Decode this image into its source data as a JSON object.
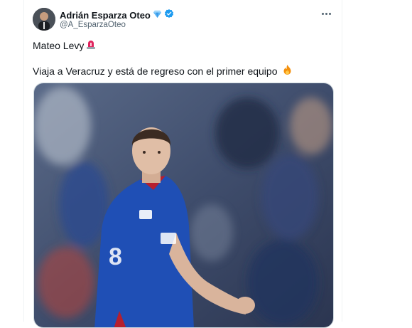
{
  "tweet": {
    "author_name": "Adrián Esparza Oteo",
    "author_handle": "@A_EsparzaOteo",
    "line1_text": "Mateo Levy",
    "line1_emoji": "siren-emoji",
    "line2_text": "Viaja a Veracruz y está de regreso con el primer equipo",
    "line2_emoji": "fire-emoji",
    "badges": [
      "diamond-icon",
      "verified-badge-icon"
    ],
    "more_icon": "more-options-icon"
  },
  "colors": {
    "text_primary": "#0f1419",
    "text_secondary": "#536471",
    "verified_blue": "#1d9bf0",
    "kit_blue": "#1f4fb5",
    "siren_red": "#e0245e"
  }
}
